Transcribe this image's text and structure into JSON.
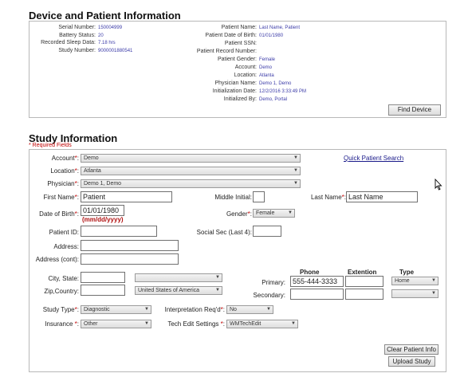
{
  "device": {
    "title": "Device and Patient Information",
    "serial_label": "Serial Number:",
    "serial_value": "150004999",
    "battery_label": "Battery Status:",
    "battery_value": "20",
    "sleep_label": "Recorded Sleep Data:",
    "sleep_value": "7.18 hrs",
    "study_label": "Study Number:",
    "study_value": "9000001880541",
    "pname_label": "Patient Name:",
    "pname_value": "Last Name, Patient",
    "pdob_label": "Patient Date of Birth:",
    "pdob_value": "01/01/1980",
    "pssn_label": "Patient SSN:",
    "pssn_value": "",
    "precord_label": "Patient Record Number:",
    "precord_value": "",
    "pgender_label": "Patient Gender:",
    "pgender_value": "Female",
    "account_label": "Account:",
    "account_value": "Demo",
    "location_label": "Location:",
    "location_value": "Atlanta",
    "physician_label": "Physician Name:",
    "physician_value": "Demo 1, Demo",
    "init_date_label": "Initialization Date:",
    "init_date_value": "12/2/2016 3:33:49 PM",
    "init_by_label": "Initialized By:",
    "init_by_value": "Demo, Portal",
    "find_device_button": "Find Device"
  },
  "study": {
    "title": "Study Information",
    "required_note": "* Required Fields",
    "account_label": "Account",
    "account_value": "Demo",
    "location_label": "Location",
    "location_value": "Atlanta",
    "physician_label": "Physician",
    "physician_value": "Demo 1, Demo",
    "quick_search_link": "Quick Patient Search",
    "first_name_label": "First Name",
    "first_name_value": "Patient",
    "middle_initial_label": "Middle Initial:",
    "middle_initial_value": "",
    "last_name_label": "Last Name",
    "last_name_value": "Last Name",
    "dob_label": "Date of Birth",
    "dob_value": "01/01/1980",
    "dob_hint": "(mm/dd/yyyy)",
    "gender_label": "Gender",
    "gender_value": "Female",
    "patient_id_label": "Patient ID:",
    "patient_id_value": "",
    "ssn_label": "Social Sec (Last 4):",
    "ssn_value": "",
    "address_label": "Address:",
    "address_value": "",
    "address2_label": "Address (cont):",
    "address2_value": "",
    "city_state_label": "City, State:",
    "city_value": "",
    "state_value": "",
    "zip_country_label": "Zip,Country:",
    "zip_value": "",
    "country_value": "United States of America",
    "phone_header": "Phone",
    "ext_header": "Extention",
    "type_header": "Type",
    "primary_label": "Primary:",
    "primary_phone": "555-444-3333",
    "primary_ext": "",
    "primary_type": "Home",
    "secondary_label": "Secondary:",
    "secondary_phone": "",
    "secondary_ext": "",
    "secondary_type": "",
    "study_type_label": "Study Type",
    "study_type_value": "Diagnostic",
    "interp_label": "Interpretation Req'd",
    "interp_value": "No",
    "insurance_label": "Insurance",
    "insurance_value": "Other",
    "tech_edit_label": "Tech Edit Settings",
    "tech_edit_value": "WMTechEdit",
    "req_star": "*",
    "colon": ":",
    "clear_button": "Clear Patient Info",
    "upload_button": "Upload Study"
  }
}
